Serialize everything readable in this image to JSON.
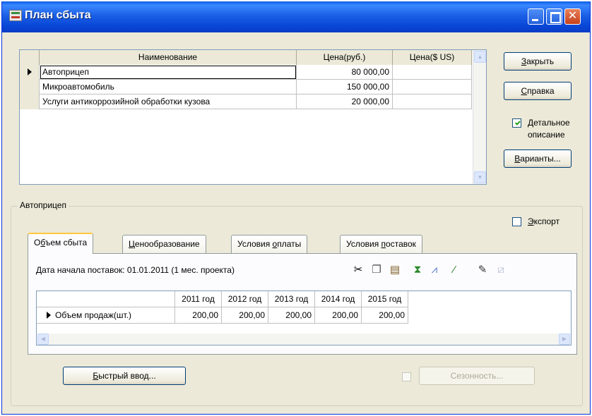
{
  "window": {
    "title": "План сбыта"
  },
  "products_table": {
    "headers": [
      "Наименование",
      "Цена(руб.)",
      "Цена($ US)"
    ],
    "rows": [
      {
        "name": "Автоприцеп",
        "price_rub": "80 000,00",
        "price_usd": ""
      },
      {
        "name": "Микроавтомобиль",
        "price_rub": "150 000,00",
        "price_usd": ""
      },
      {
        "name": "Услуги антикоррозийной обработки кузова",
        "price_rub": "20 000,00",
        "price_usd": ""
      }
    ]
  },
  "buttons": {
    "close": {
      "pre": "",
      "u": "З",
      "post": "акрыть"
    },
    "help": {
      "pre": "",
      "u": "С",
      "post": "правка"
    },
    "variants": {
      "pre": "",
      "u": "В",
      "post": "арианты..."
    },
    "quick_input": {
      "pre": "",
      "u": "Б",
      "post": "ыстрый ввод..."
    },
    "seasonality": "Сезонность..."
  },
  "detail_option": {
    "checked": true,
    "line1_pre": "",
    "line1_u": "Д",
    "line1_post": "етальное",
    "line2": "описание"
  },
  "export_option": {
    "checked": false,
    "pre": "",
    "u": "Э",
    "post": "кспорт"
  },
  "group": {
    "title": "Автоприцеп"
  },
  "tabs": [
    {
      "pre": "О",
      "u": "б",
      "post": "ъем сбыта"
    },
    {
      "pre": "",
      "u": "Ц",
      "post": "енообразование"
    },
    {
      "pre": "Условия ",
      "u": "о",
      "post": "платы"
    },
    {
      "pre": "Условия ",
      "u": "п",
      "post": "оставок"
    }
  ],
  "delivery_start": "Дата начала поставок:  01.01.2011 (1 мес. проекта)",
  "volume_table": {
    "years": [
      "2011 год",
      "2012 год",
      "2013 год",
      "2014 год",
      "2015 год"
    ],
    "row_label": "Объем продаж(шт.)",
    "values": [
      "200,00",
      "200,00",
      "200,00",
      "200,00",
      "200,00"
    ]
  },
  "toolbar_icons": [
    "scissors-icon",
    "copy-icon",
    "paste-icon",
    "hourglass-icon",
    "chart-icon",
    "wand-icon",
    "pencil-icon",
    "disabled-chart-icon"
  ]
}
